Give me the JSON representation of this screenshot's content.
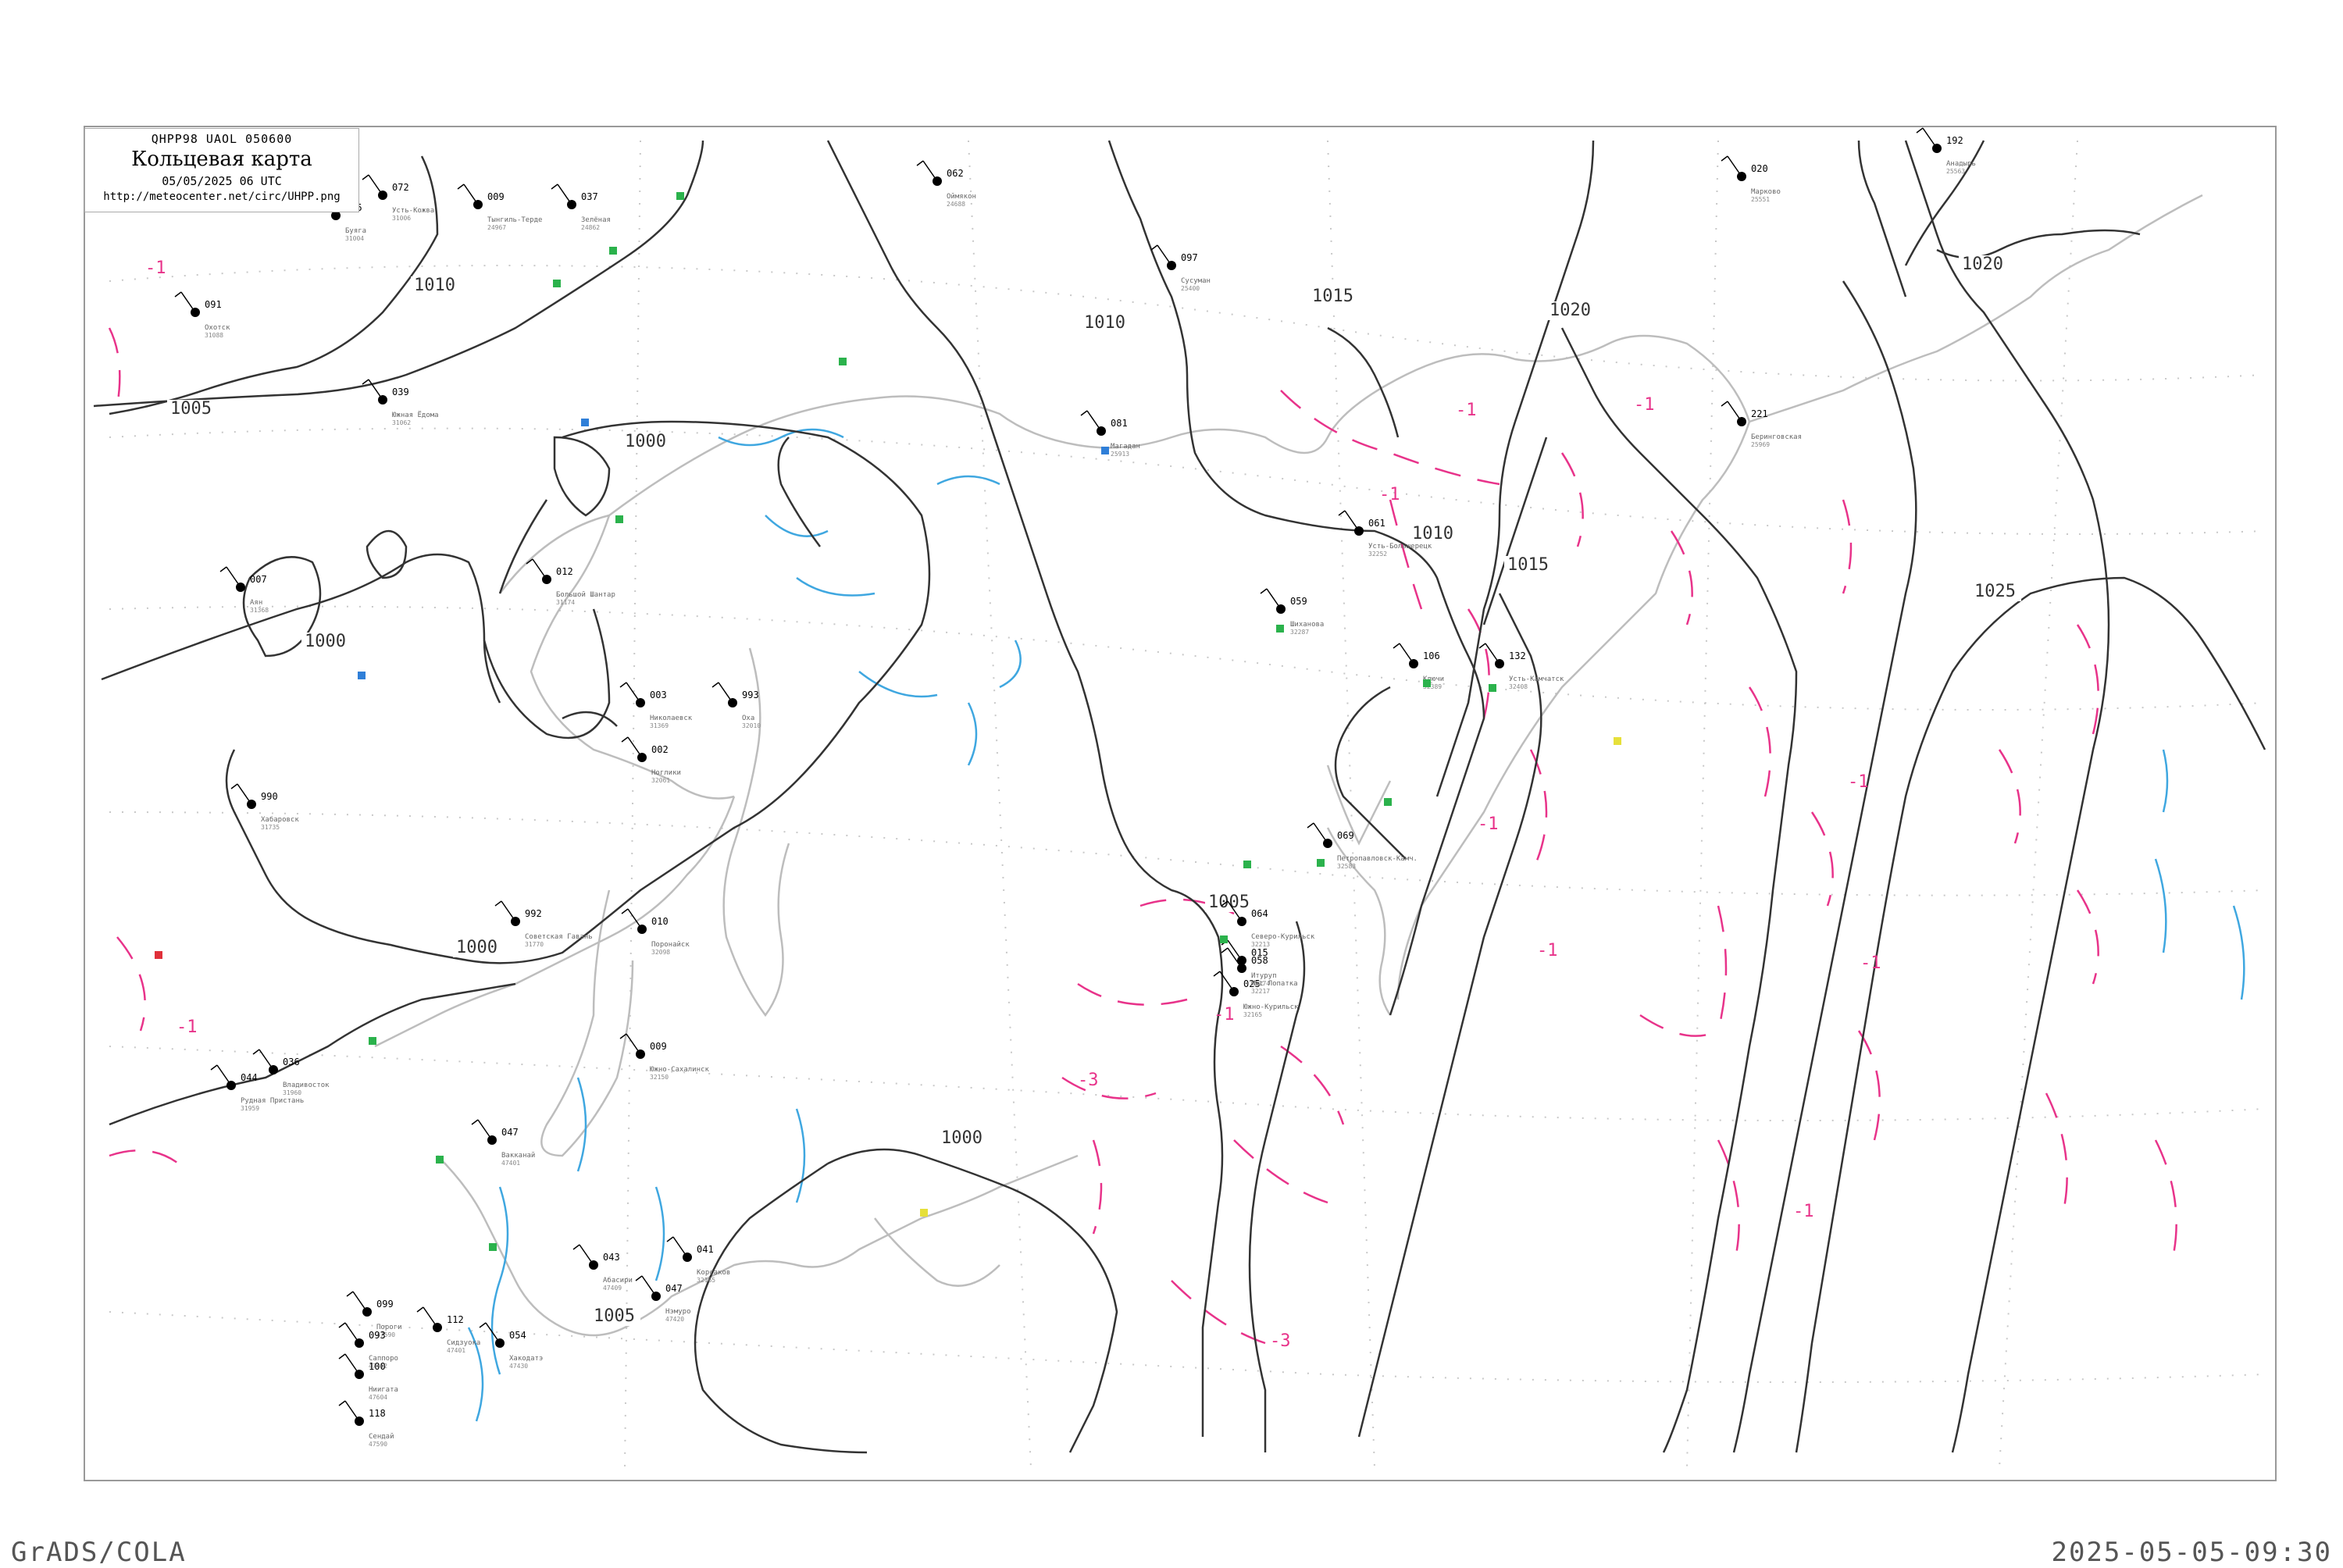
{
  "header": {
    "code": "QHPP98  UAOL  050600",
    "title": "Кольцевая карта",
    "datetime": "05/05/2025 06 UTC",
    "url": "http://meteocenter.net/circ/UHPP.png"
  },
  "footer": {
    "left": "GrADS/COLA",
    "right": "2025-05-05-09:30"
  },
  "colors": {
    "isobar": "#333333",
    "coast": "#bbbbbb",
    "rivers": "#3fa7e0",
    "neg_tendency": "#e8338a",
    "station_green": "#2bb24c",
    "station_blue": "#2f7fd8"
  },
  "isobar_labels": [
    "1010",
    "1005",
    "1000",
    "1000",
    "1000",
    "1005",
    "1000",
    "1005",
    "1010",
    "1015",
    "1020",
    "1020",
    "1010",
    "1015",
    "1025"
  ],
  "tendency_labels": [
    "-1",
    "-1",
    "-1",
    "-1",
    "-1",
    "-1",
    "-1",
    "-3",
    "-3",
    "-1",
    "-1",
    "-1",
    "-1"
  ],
  "stations": [
    {
      "name": "Усть-Кожва",
      "id": "31006",
      "p": "072"
    },
    {
      "name": "Тынгиль-Терде",
      "id": "24967",
      "p": "009"
    },
    {
      "name": "Зелёная",
      "id": "24862",
      "p": "037"
    },
    {
      "name": "Большой Шантар",
      "id": "31174",
      "p": "012"
    },
    {
      "name": "Охотск",
      "id": "31088",
      "p": "091"
    },
    {
      "name": "Аян",
      "id": "31368",
      "p": "007"
    },
    {
      "name": "Николаевск",
      "id": "31369",
      "p": "003"
    },
    {
      "name": "Оха",
      "id": "32010",
      "p": "993"
    },
    {
      "name": "Ноглики",
      "id": "32061",
      "p": "002"
    },
    {
      "name": "Поронайск",
      "id": "32098",
      "p": "010"
    },
    {
      "name": "Южно-Сахалинск",
      "id": "32150",
      "p": "009"
    },
    {
      "name": "Корсаков",
      "id": "32165",
      "p": "041"
    },
    {
      "name": "Петропавловск-Камч.",
      "id": "32583",
      "p": "069"
    },
    {
      "name": "Усть-Камчатск",
      "id": "32408",
      "p": "132"
    },
    {
      "name": "Ключи",
      "id": "32389",
      "p": "106"
    },
    {
      "name": "Шиханова",
      "id": "32287",
      "p": "059"
    },
    {
      "name": "Усть-Большерецк",
      "id": "32252",
      "p": "061"
    },
    {
      "name": "Рудная Пристань",
      "id": "31959",
      "p": "044"
    },
    {
      "name": "Владивосток",
      "id": "31960",
      "p": "036"
    },
    {
      "name": "Хабаровск",
      "id": "31735",
      "p": "990"
    },
    {
      "name": "Советская Гавань",
      "id": "31770",
      "p": "992"
    },
    {
      "name": "Северо-Курильск",
      "id": "32213",
      "p": "064"
    },
    {
      "name": "Марково",
      "id": "25551",
      "p": "020"
    },
    {
      "name": "Анадырь",
      "id": "25563",
      "p": "192"
    },
    {
      "name": "Беринговская",
      "id": "25969",
      "p": "221"
    },
    {
      "name": "Южно-Курильск",
      "id": "32165",
      "p": "025"
    },
    {
      "name": "Итуруп",
      "id": "32174",
      "p": "015"
    },
    {
      "name": "Пороги",
      "id": "47590",
      "p": "099"
    },
    {
      "name": "Мыс Лопатка",
      "id": "32217",
      "p": "058"
    },
    {
      "name": "Оймякон",
      "id": "24688",
      "p": "062"
    },
    {
      "name": "Буяга",
      "id": "31004",
      "p": "105"
    },
    {
      "name": "Южная Ёдома",
      "id": "31062",
      "p": "039"
    },
    {
      "name": "Сусуман",
      "id": "25400",
      "p": "097"
    },
    {
      "name": "Магадан",
      "id": "25913",
      "p": "081"
    },
    {
      "name": "Вакканай",
      "id": "47401",
      "p": "047"
    },
    {
      "name": "Абасири",
      "id": "47409",
      "p": "043"
    },
    {
      "name": "Нэмуро",
      "id": "47420",
      "p": "047"
    },
    {
      "name": "Хакодатэ",
      "id": "47430",
      "p": "054"
    },
    {
      "name": "Сидзуока",
      "id": "47401",
      "p": "112"
    },
    {
      "name": "Саппоро",
      "id": "47412",
      "p": "093"
    },
    {
      "name": "Ниигата",
      "id": "47604",
      "p": "100"
    },
    {
      "name": "Сендай",
      "id": "47590",
      "p": "118"
    }
  ]
}
